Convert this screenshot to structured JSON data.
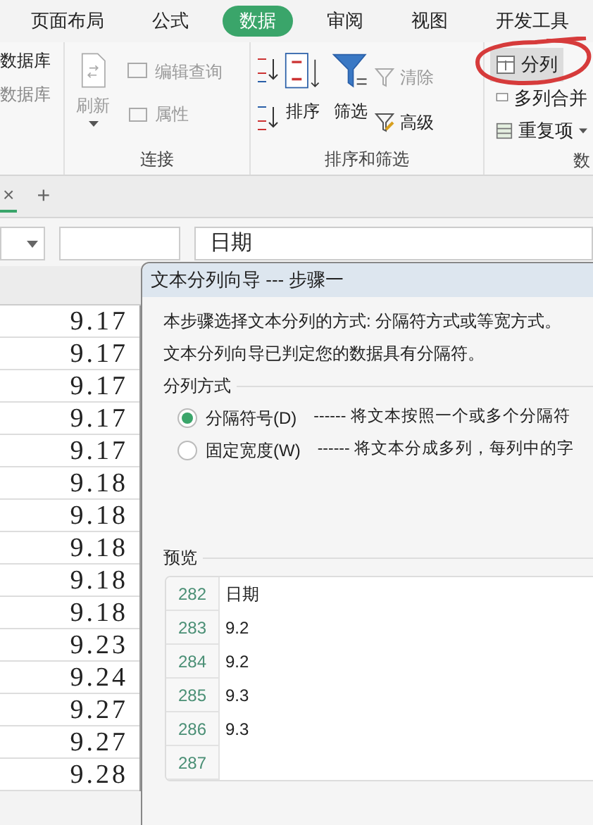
{
  "menu_tabs": [
    {
      "label": "页面布局",
      "selected": false
    },
    {
      "label": "公式",
      "selected": false
    },
    {
      "label": "数据",
      "selected": true
    },
    {
      "label": "审阅",
      "selected": false
    },
    {
      "label": "视图",
      "selected": false
    },
    {
      "label": "开发工具",
      "selected": false
    }
  ],
  "ribbon": {
    "database_items": [
      "数据库",
      "数据库"
    ],
    "refresh": {
      "label": "刷新",
      "disabled": true
    },
    "edit_query": {
      "label": "编辑查询",
      "disabled": true
    },
    "properties": {
      "label": "属性",
      "disabled": true
    },
    "connection_group": "连接",
    "sort": "排序",
    "filter": "筛选",
    "clear": {
      "label": "清除",
      "disabled": true
    },
    "advanced": {
      "label": "高级",
      "disabled": false
    },
    "split": "分列",
    "merge": "多列合并",
    "duplicates": "重复项",
    "sort_filter_group": "排序和筛选",
    "data_group": "数"
  },
  "sheet_tabs": {
    "close": "×",
    "add": "+"
  },
  "formula_bar": {
    "content": "日期"
  },
  "cells": [
    "9.17",
    "9.17",
    "9.17",
    "9.17",
    "9.17",
    "9.18",
    "9.18",
    "9.18",
    "9.18",
    "9.18",
    "9.23",
    "9.24",
    "9.27",
    "9.27",
    "9.28"
  ],
  "dialog": {
    "title": "文本分列向导 --- 步骤一",
    "lines": [
      "本步骤选择文本分列的方式: 分隔符方式或等宽方式。",
      "文本分列向导已判定您的数据具有分隔符。"
    ],
    "section": "分列方式",
    "options": [
      {
        "label": "分隔符号(D)",
        "description": "------ 将文本按照一个或多个分隔符",
        "selected": true
      },
      {
        "label": "固定宽度(W)",
        "description": "------ 将文本分成多列，每列中的字",
        "selected": false
      }
    ],
    "preview_label": "预览",
    "preview_rows": [
      {
        "number": "282",
        "text": "日期"
      },
      {
        "number": "283",
        "text": "9.2"
      },
      {
        "number": "284",
        "text": "9.2"
      },
      {
        "number": "285",
        "text": "9.3"
      },
      {
        "number": "286",
        "text": "9.3"
      },
      {
        "number": "287"
      }
    ]
  }
}
